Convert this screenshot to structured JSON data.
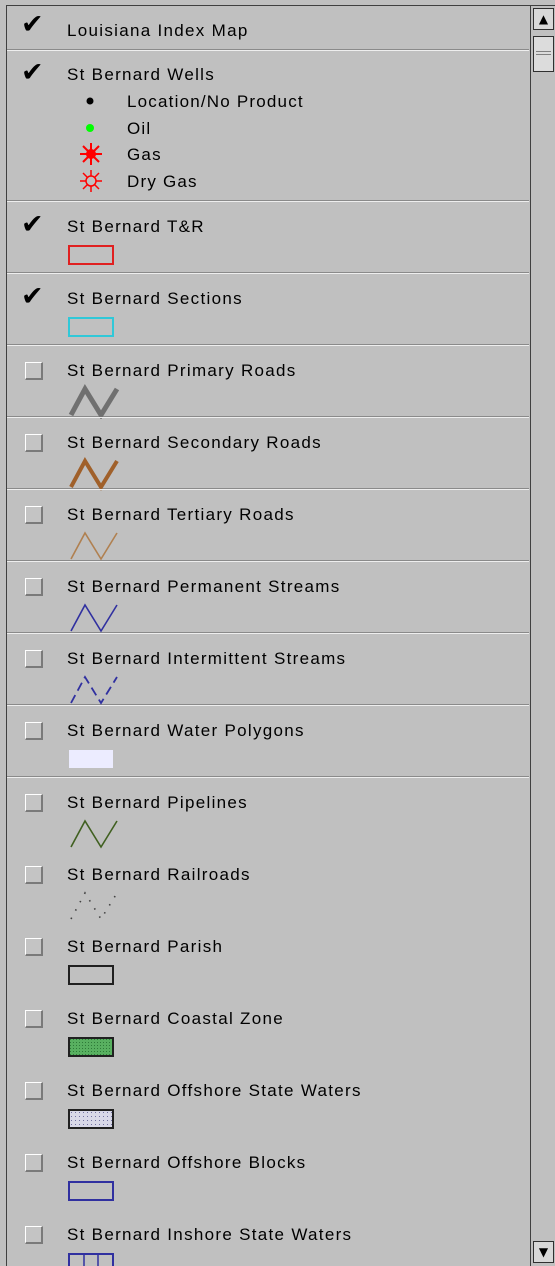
{
  "layers": [
    {
      "name": "Louisiana Index Map",
      "checked": true
    },
    {
      "name": "St Bernard Wells",
      "checked": true,
      "legend_items": [
        {
          "icon": "black-dot-icon",
          "label": "Location/No Product",
          "color": "#000000"
        },
        {
          "icon": "green-dot-icon",
          "label": "Oil",
          "color": "#00ff00"
        },
        {
          "icon": "red-star-icon",
          "label": "Gas",
          "color": "#ff0000"
        },
        {
          "icon": "red-open-star-icon",
          "label": "Dry Gas",
          "color": "#ff0000"
        }
      ]
    },
    {
      "name": "St Bernard T&R",
      "checked": true,
      "symbol": "red-rectangle-icon",
      "color": "#e02020"
    },
    {
      "name": "St Bernard Sections",
      "checked": true,
      "symbol": "cyan-rectangle-icon",
      "color": "#30c8d8"
    },
    {
      "name": "St Bernard Primary Roads",
      "checked": false,
      "symbol": "gray-zigzag-line-icon",
      "color": "#707070"
    },
    {
      "name": "St Bernard Secondary Roads",
      "checked": false,
      "symbol": "brown-zigzag-line-icon",
      "color": "#a0602a"
    },
    {
      "name": "St Bernard Tertiary Roads",
      "checked": false,
      "symbol": "tan-zigzag-line-icon",
      "color": "#b08050"
    },
    {
      "name": "St Bernard Permanent Streams",
      "checked": false,
      "symbol": "blue-zigzag-line-icon",
      "color": "#3030a0"
    },
    {
      "name": "St Bernard Intermittent Streams",
      "checked": false,
      "symbol": "blue-dashed-zigzag-icon",
      "color": "#3030a0"
    },
    {
      "name": "St Bernard Water Polygons",
      "checked": false,
      "symbol": "lavender-fill-icon",
      "color": "#ececff"
    },
    {
      "name": "St Bernard Pipelines",
      "checked": false,
      "symbol": "green-zigzag-line-icon",
      "color": "#406020"
    },
    {
      "name": "St Bernard Railroads",
      "checked": false,
      "symbol": "dotted-zigzag-icon",
      "color": "#404040"
    },
    {
      "name": "St Bernard Parish",
      "checked": false,
      "symbol": "black-rectangle-icon",
      "color": "#202020"
    },
    {
      "name": "St Bernard Coastal Zone",
      "checked": false,
      "symbol": "green-fill-rectangle-icon",
      "color": "#58b060"
    },
    {
      "name": "St Bernard Offshore State Waters",
      "checked": false,
      "symbol": "stippled-rectangle-icon",
      "color": "#9090c0"
    },
    {
      "name": "St Bernard Offshore Blocks",
      "checked": false,
      "symbol": "blue-rectangle-icon",
      "color": "#3030a0"
    },
    {
      "name": "St Bernard Inshore State Waters",
      "checked": false,
      "symbol": "blue-grid-rectangle-icon",
      "color": "#3030a0"
    }
  ],
  "scrollbar": {
    "up_icon": "up-arrow-icon",
    "down_icon": "down-arrow-icon"
  }
}
